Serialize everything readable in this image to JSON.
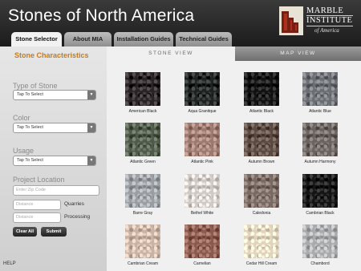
{
  "header": {
    "title": "Stones of North America",
    "logo_line1": "MARBLE",
    "logo_line2": "INSTITUTE",
    "logo_line3": "of America"
  },
  "tabs": [
    {
      "label": "Stone Selector",
      "active": true
    },
    {
      "label": "About MIA",
      "active": false
    },
    {
      "label": "Installation Guides",
      "active": false
    },
    {
      "label": "Technical Guides",
      "active": false
    }
  ],
  "sidebar": {
    "title": "Stone Characteristics",
    "type_label": "Type of Stone",
    "type_value": "Tap To Select",
    "color_label": "Color",
    "color_value": "Tap To Select",
    "usage_label": "Usage",
    "usage_value": "Tap To Select",
    "location_label": "Project Location",
    "zip_placeholder": "Enter Zip Code",
    "distance_placeholder": "Distance",
    "quarries_label": "Quarries",
    "processing_label": "Processing",
    "clear_label": "Clear All",
    "submit_label": "Submit",
    "help_label": "HELP"
  },
  "views": {
    "stone": "STONE VIEW",
    "map": "MAP VIEW"
  },
  "stones": [
    {
      "name": "American Black",
      "color": "#2a2326"
    },
    {
      "name": "Aqua Granitque",
      "color": "#1e2322"
    },
    {
      "name": "Atlantic Black",
      "color": "#111111"
    },
    {
      "name": "Atlantic Blue",
      "color": "#6b6f73"
    },
    {
      "name": "Atlantic Green",
      "color": "#4f5a4a"
    },
    {
      "name": "Atlantic Pink",
      "color": "#9c7a70"
    },
    {
      "name": "Autumn Brown",
      "color": "#5a4a42"
    },
    {
      "name": "Autumn Harmony",
      "color": "#6a6360"
    },
    {
      "name": "Barre Gray",
      "color": "#9a9ea2"
    },
    {
      "name": "Bethel White",
      "color": "#cfcac5"
    },
    {
      "name": "Caledonia",
      "color": "#7a6a64"
    },
    {
      "name": "Cambrian Black",
      "color": "#141414"
    },
    {
      "name": "Cambrian Cream",
      "color": "#c8b3a4"
    },
    {
      "name": "Carnelian",
      "color": "#8a5a4e"
    },
    {
      "name": "Cedar Hill Cream",
      "color": "#e0d4bd"
    },
    {
      "name": "Chambord",
      "color": "#a8aaab"
    }
  ]
}
